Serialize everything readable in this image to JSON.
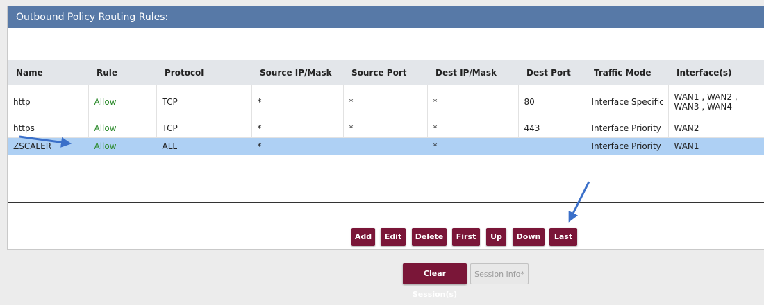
{
  "panel": {
    "title": "Outbound Policy Routing Rules:"
  },
  "table": {
    "headers": [
      "Name",
      "Rule",
      "Protocol",
      "Source IP/Mask",
      "Source Port",
      "Dest IP/Mask",
      "Dest Port",
      "Traffic Mode",
      "Interface(s)"
    ],
    "rows": [
      {
        "name": "http",
        "rule": "Allow",
        "protocol": "TCP",
        "source_ip": "*",
        "source_port": "*",
        "dest_ip": "*",
        "dest_port": "80",
        "traffic_mode": "Interface Specific",
        "interfaces": "WAN1 , WAN2 , WAN3 , WAN4"
      },
      {
        "name": "https",
        "rule": "Allow",
        "protocol": "TCP",
        "source_ip": "*",
        "source_port": "*",
        "dest_ip": "*",
        "dest_port": "443",
        "traffic_mode": "Interface Priority",
        "interfaces": "WAN2"
      },
      {
        "name": "ZSCALER",
        "rule": "Allow",
        "protocol": "ALL",
        "source_ip": "*",
        "source_port": "",
        "dest_ip": "*",
        "dest_port": "",
        "traffic_mode": "Interface Priority",
        "interfaces": "WAN1"
      }
    ]
  },
  "toolbar": {
    "add_label": "Add",
    "edit_label": "Edit",
    "delete_label": "Delete",
    "first_label": "First",
    "up_label": "Up",
    "down_label": "Down",
    "last_label": "Last"
  },
  "footer": {
    "clear_label": "Clear Session(s)",
    "info_label": "Session Info*"
  },
  "colors": {
    "header_bar": "#5779a7",
    "button": "#7a1638",
    "selected_row": "#aed0f4",
    "allow_text": "#2e8b2e",
    "annotation_arrow": "#3a6fc9"
  }
}
